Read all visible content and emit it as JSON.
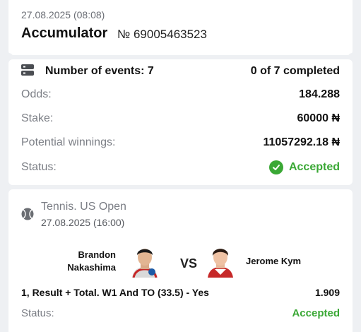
{
  "ticket": {
    "date": "27.08.2025 (08:08)",
    "title": "Accumulator",
    "number": "№ 69005463523"
  },
  "summary": {
    "events_label": "Number of events: 7",
    "completed": "0 of 7 completed",
    "odds_label": "Odds:",
    "odds_value": "184.288",
    "stake_label": "Stake:",
    "stake_value": "60000 ₦",
    "winnings_label": "Potential winnings:",
    "winnings_value": "11057292.18 ₦",
    "status_label": "Status:",
    "status_value": "Accepted",
    "accent_green": "#3aa835"
  },
  "event": {
    "sport": "Tennis. US Open",
    "date": "27.08.2025 (16:00)",
    "player1_line1": "Brandon",
    "player1_line2": "Nakashima",
    "vs": "VS",
    "player2": "Jerome Kym",
    "bet": "1, Result + Total. W1 And TO (33.5) - Yes",
    "odds": "1.909",
    "status_label": "Status:",
    "status_value": "Accepted"
  },
  "icons": {
    "events": "list-icon",
    "status": "check-circle-icon",
    "sport": "tennis-ball-icon"
  }
}
